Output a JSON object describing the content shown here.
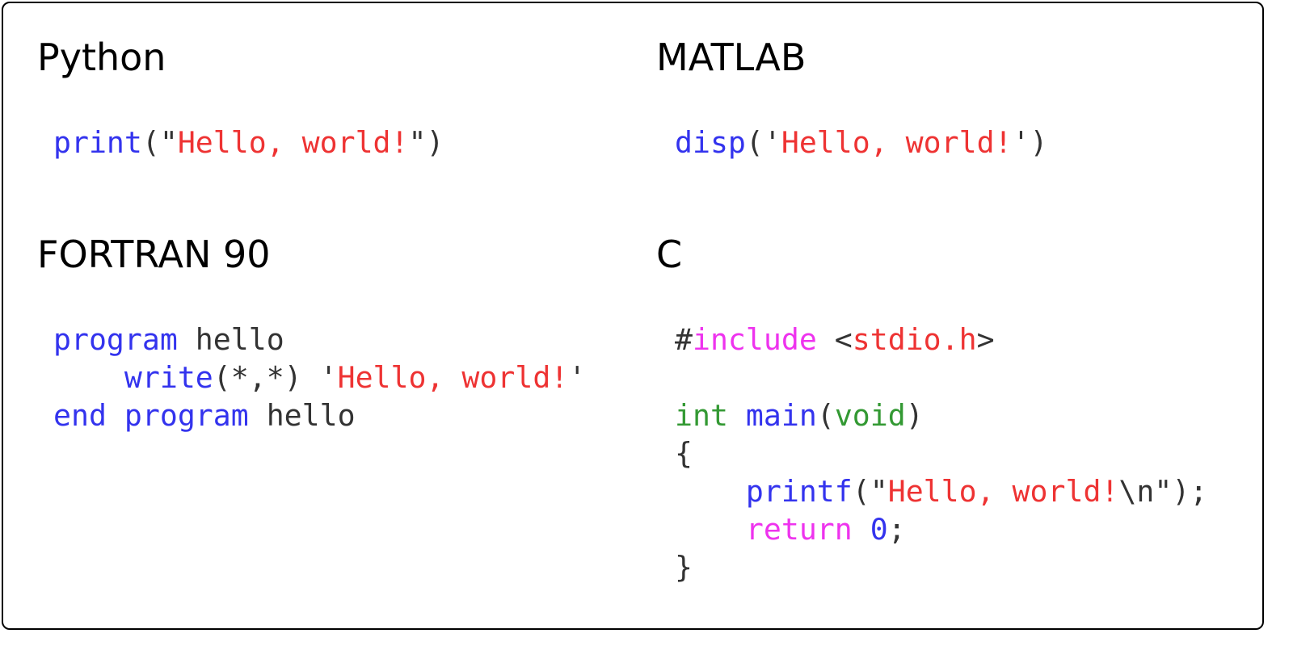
{
  "colors": {
    "keyword": "#3333ee",
    "string": "#ee3333",
    "type": "#339933",
    "preprocessor": "#ee33ee",
    "number": "#3333ee",
    "punctuation": "#333333",
    "border": "#000000"
  },
  "panels": [
    {
      "title": "Python",
      "lines": [
        [
          {
            "t": "print",
            "c": "kw"
          },
          {
            "t": "(\"",
            "c": "pun"
          },
          {
            "t": "Hello, world!",
            "c": "str"
          },
          {
            "t": "\")",
            "c": "pun"
          }
        ]
      ]
    },
    {
      "title": "MATLAB",
      "lines": [
        [
          {
            "t": "disp",
            "c": "kw"
          },
          {
            "t": "('",
            "c": "pun"
          },
          {
            "t": "Hello, world!",
            "c": "str"
          },
          {
            "t": "')",
            "c": "pun"
          }
        ]
      ]
    },
    {
      "title": "FORTRAN 90",
      "lines": [
        [
          {
            "t": "program",
            "c": "kw"
          },
          {
            "t": " hello",
            "c": "txt"
          }
        ],
        [
          {
            "t": "    ",
            "c": "txt"
          },
          {
            "t": "write",
            "c": "kw"
          },
          {
            "t": "(*,*) '",
            "c": "pun"
          },
          {
            "t": "Hello, world!",
            "c": "str"
          },
          {
            "t": "'",
            "c": "pun"
          }
        ],
        [
          {
            "t": "end program",
            "c": "kw"
          },
          {
            "t": " hello",
            "c": "txt"
          }
        ]
      ]
    },
    {
      "title": "C",
      "lines": [
        [
          {
            "t": "#",
            "c": "pun"
          },
          {
            "t": "include",
            "c": "pre"
          },
          {
            "t": " <",
            "c": "pun"
          },
          {
            "t": "stdio.h",
            "c": "str"
          },
          {
            "t": ">",
            "c": "pun"
          }
        ],
        [],
        [
          {
            "t": "int",
            "c": "typ"
          },
          {
            "t": " ",
            "c": "txt"
          },
          {
            "t": "main",
            "c": "kw"
          },
          {
            "t": "(",
            "c": "pun"
          },
          {
            "t": "void",
            "c": "typ"
          },
          {
            "t": ")",
            "c": "pun"
          }
        ],
        [
          {
            "t": "{",
            "c": "pun"
          }
        ],
        [
          {
            "t": "    ",
            "c": "txt"
          },
          {
            "t": "printf",
            "c": "kw"
          },
          {
            "t": "(\"",
            "c": "pun"
          },
          {
            "t": "Hello, world!",
            "c": "str"
          },
          {
            "t": "\\n\");",
            "c": "pun"
          }
        ],
        [
          {
            "t": "    ",
            "c": "txt"
          },
          {
            "t": "return",
            "c": "pre"
          },
          {
            "t": " ",
            "c": "txt"
          },
          {
            "t": "0",
            "c": "num"
          },
          {
            "t": ";",
            "c": "pun"
          }
        ],
        [
          {
            "t": "}",
            "c": "pun"
          }
        ]
      ]
    }
  ]
}
